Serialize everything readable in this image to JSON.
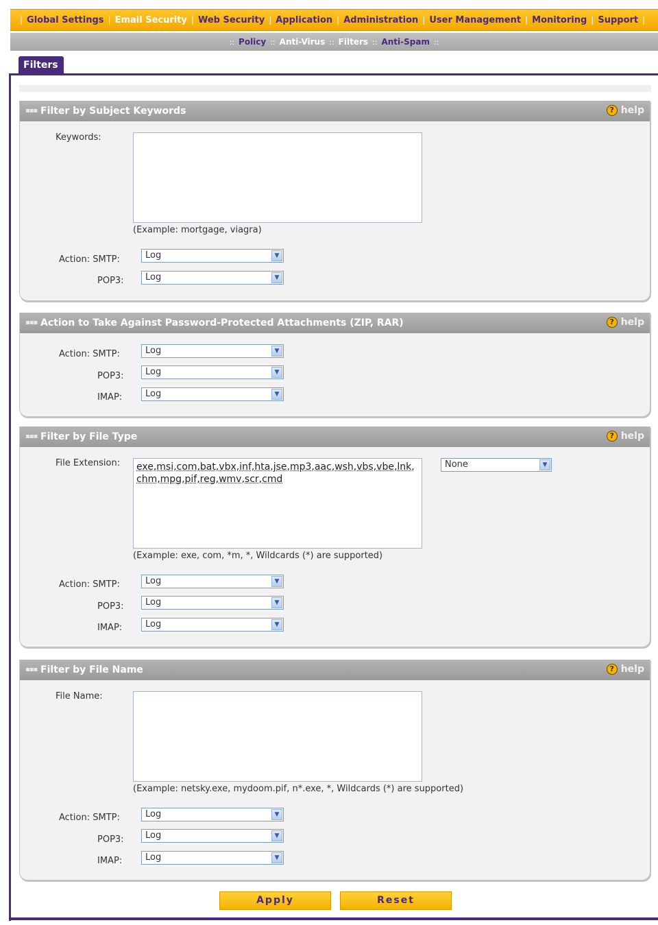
{
  "nav": {
    "items": [
      "Global Settings",
      "Email Security",
      "Web Security",
      "Application",
      "Administration",
      "User Management",
      "Monitoring",
      "Support"
    ]
  },
  "subnav": {
    "items": [
      "Policy",
      "Anti-Virus",
      "Filters",
      "Anti-Spam"
    ]
  },
  "tab": {
    "label": "Filters"
  },
  "help_label": "help",
  "sections": {
    "subject": {
      "title": "Filter by Subject Keywords",
      "keywords_label": "Keywords:",
      "keywords_value": "",
      "example": "(Example: mortgage, viagra)",
      "action_smtp_label": "Action: SMTP:",
      "pop3_label": "POP3:",
      "smtp_value": "Log",
      "pop3_value": "Log"
    },
    "password": {
      "title": "Action to Take Against Password-Protected Attachments (ZIP, RAR)",
      "action_smtp_label": "Action: SMTP:",
      "pop3_label": "POP3:",
      "imap_label": "IMAP:",
      "smtp_value": "Log",
      "pop3_value": "Log",
      "imap_value": "Log"
    },
    "filetype": {
      "title": "Filter by File Type",
      "ext_label": "File Extension:",
      "ext_value": "exe,msi,com,bat,vbx,inf,hta,jse,mp3,aac,wsh,vbs,vbe,lnk,chm,mpg,pif,reg,wmv,scr,cmd",
      "preset_value": "None",
      "example": "(Example: exe, com, *m, *, Wildcards (*) are supported)",
      "action_smtp_label": "Action: SMTP:",
      "pop3_label": "POP3:",
      "imap_label": "IMAP:",
      "smtp_value": "Log",
      "pop3_value": "Log",
      "imap_value": "Log"
    },
    "filename": {
      "title": "Filter by File Name",
      "name_label": "File Name:",
      "name_value": "",
      "example": "(Example: netsky.exe, mydoom.pif, n*.exe, *, Wildcards (*) are supported)",
      "action_smtp_label": "Action: SMTP:",
      "pop3_label": "POP3:",
      "imap_label": "IMAP:",
      "smtp_value": "Log",
      "pop3_value": "Log",
      "imap_value": "Log"
    }
  },
  "buttons": {
    "apply": "Apply",
    "reset": "Reset"
  },
  "colors": {
    "nav_orange": "#f5a800",
    "brand_purple": "#4a2a7a",
    "header_gray": "#a6a6a6"
  }
}
